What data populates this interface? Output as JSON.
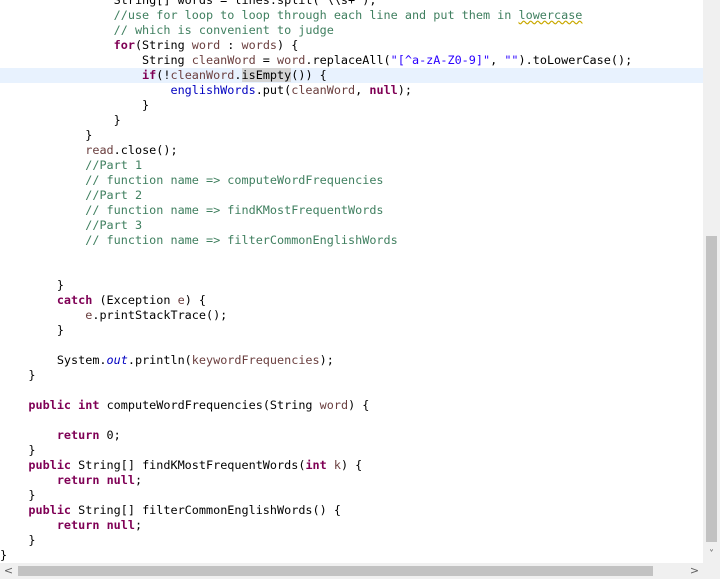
{
  "theme": {
    "keyword": "#7f0055",
    "comment": "#3f7f5f",
    "string": "#2a00ff",
    "field": "#0000c0",
    "variable": "#6a3e3e",
    "current_line": "#e8f2fe",
    "occurrence_highlight": "#d4d4d4"
  },
  "code_lines": [
    {
      "current": false,
      "tokens": [
        {
          "t": "                String[] words = lines.split(\"\\\\s+\");",
          "c": ""
        }
      ]
    },
    {
      "current": false,
      "tokens": [
        {
          "t": "                ",
          "c": ""
        },
        {
          "t": "//use for loop to loop through each line and put them in ",
          "c": "cm"
        },
        {
          "t": "lowercase",
          "c": "cm sq"
        }
      ]
    },
    {
      "current": false,
      "tokens": [
        {
          "t": "                ",
          "c": ""
        },
        {
          "t": "// which is convenient to judge",
          "c": "cm"
        }
      ]
    },
    {
      "current": false,
      "tokens": [
        {
          "t": "                ",
          "c": ""
        },
        {
          "t": "for",
          "c": "kw"
        },
        {
          "t": "(String ",
          "c": ""
        },
        {
          "t": "word",
          "c": "vr"
        },
        {
          "t": " : ",
          "c": ""
        },
        {
          "t": "words",
          "c": "vr"
        },
        {
          "t": ") {",
          "c": ""
        }
      ]
    },
    {
      "current": false,
      "tokens": [
        {
          "t": "                    String ",
          "c": ""
        },
        {
          "t": "cleanWord",
          "c": "vr"
        },
        {
          "t": " = ",
          "c": ""
        },
        {
          "t": "word",
          "c": "vr"
        },
        {
          "t": ".replaceAll(",
          "c": ""
        },
        {
          "t": "\"[^a-zA-Z0-9]\"",
          "c": "st"
        },
        {
          "t": ", ",
          "c": ""
        },
        {
          "t": "\"\"",
          "c": "st"
        },
        {
          "t": ").toLowerCase();",
          "c": ""
        }
      ]
    },
    {
      "current": true,
      "tokens": [
        {
          "t": "                    ",
          "c": ""
        },
        {
          "t": "if",
          "c": "kw"
        },
        {
          "t": "(!",
          "c": ""
        },
        {
          "t": "cleanWord",
          "c": "vr"
        },
        {
          "t": ".",
          "c": ""
        },
        {
          "t": "isEmpty",
          "c": "hl"
        },
        {
          "t": "()) {",
          "c": ""
        }
      ]
    },
    {
      "current": false,
      "tokens": [
        {
          "t": "                        ",
          "c": ""
        },
        {
          "t": "englishWords",
          "c": "fd"
        },
        {
          "t": ".put(",
          "c": ""
        },
        {
          "t": "cleanWord",
          "c": "vr"
        },
        {
          "t": ", ",
          "c": ""
        },
        {
          "t": "null",
          "c": "kw"
        },
        {
          "t": ");",
          "c": ""
        }
      ]
    },
    {
      "current": false,
      "tokens": [
        {
          "t": "                    }",
          "c": ""
        }
      ]
    },
    {
      "current": false,
      "tokens": [
        {
          "t": "                }",
          "c": ""
        }
      ]
    },
    {
      "current": false,
      "tokens": [
        {
          "t": "            }",
          "c": ""
        }
      ]
    },
    {
      "current": false,
      "tokens": [
        {
          "t": "            ",
          "c": ""
        },
        {
          "t": "read",
          "c": "vr"
        },
        {
          "t": ".close();",
          "c": ""
        }
      ]
    },
    {
      "current": false,
      "tokens": [
        {
          "t": "            ",
          "c": ""
        },
        {
          "t": "//Part 1",
          "c": "cm"
        }
      ]
    },
    {
      "current": false,
      "tokens": [
        {
          "t": "            ",
          "c": ""
        },
        {
          "t": "// function name => computeWordFrequencies",
          "c": "cm"
        }
      ]
    },
    {
      "current": false,
      "tokens": [
        {
          "t": "            ",
          "c": ""
        },
        {
          "t": "//Part 2",
          "c": "cm"
        }
      ]
    },
    {
      "current": false,
      "tokens": [
        {
          "t": "            ",
          "c": ""
        },
        {
          "t": "// function name => findKMostFrequentWords",
          "c": "cm"
        }
      ]
    },
    {
      "current": false,
      "tokens": [
        {
          "t": "            ",
          "c": ""
        },
        {
          "t": "//Part 3",
          "c": "cm"
        }
      ]
    },
    {
      "current": false,
      "tokens": [
        {
          "t": "            ",
          "c": ""
        },
        {
          "t": "// function name => filterCommonEnglishWords",
          "c": "cm"
        }
      ]
    },
    {
      "current": false,
      "tokens": [
        {
          "t": "",
          "c": ""
        }
      ]
    },
    {
      "current": false,
      "tokens": [
        {
          "t": "",
          "c": ""
        }
      ]
    },
    {
      "current": false,
      "tokens": [
        {
          "t": "        }",
          "c": ""
        }
      ]
    },
    {
      "current": false,
      "tokens": [
        {
          "t": "        ",
          "c": ""
        },
        {
          "t": "catch",
          "c": "kw"
        },
        {
          "t": " (Exception ",
          "c": ""
        },
        {
          "t": "e",
          "c": "vr"
        },
        {
          "t": ") {",
          "c": ""
        }
      ]
    },
    {
      "current": false,
      "tokens": [
        {
          "t": "            ",
          "c": ""
        },
        {
          "t": "e",
          "c": "vr"
        },
        {
          "t": ".printStackTrace();",
          "c": ""
        }
      ]
    },
    {
      "current": false,
      "tokens": [
        {
          "t": "        }",
          "c": ""
        }
      ]
    },
    {
      "current": false,
      "tokens": [
        {
          "t": "",
          "c": ""
        }
      ]
    },
    {
      "current": false,
      "tokens": [
        {
          "t": "        System.",
          "c": ""
        },
        {
          "t": "out",
          "c": "sf"
        },
        {
          "t": ".println(",
          "c": ""
        },
        {
          "t": "keywordFrequencies",
          "c": "vr"
        },
        {
          "t": ");",
          "c": ""
        }
      ]
    },
    {
      "current": false,
      "tokens": [
        {
          "t": "    }",
          "c": ""
        }
      ]
    },
    {
      "current": false,
      "tokens": [
        {
          "t": "",
          "c": ""
        }
      ]
    },
    {
      "current": false,
      "tokens": [
        {
          "t": "    ",
          "c": ""
        },
        {
          "t": "public",
          "c": "kw"
        },
        {
          "t": " ",
          "c": ""
        },
        {
          "t": "int",
          "c": "kw"
        },
        {
          "t": " computeWordFrequencies(String ",
          "c": ""
        },
        {
          "t": "word",
          "c": "vr"
        },
        {
          "t": ") {",
          "c": ""
        }
      ]
    },
    {
      "current": false,
      "tokens": [
        {
          "t": "",
          "c": ""
        }
      ]
    },
    {
      "current": false,
      "tokens": [
        {
          "t": "        ",
          "c": ""
        },
        {
          "t": "return",
          "c": "kw"
        },
        {
          "t": " 0;",
          "c": ""
        }
      ]
    },
    {
      "current": false,
      "tokens": [
        {
          "t": "    }",
          "c": ""
        }
      ]
    },
    {
      "current": false,
      "tokens": [
        {
          "t": "    ",
          "c": ""
        },
        {
          "t": "public",
          "c": "kw"
        },
        {
          "t": " String[] findKMostFrequentWords(",
          "c": ""
        },
        {
          "t": "int",
          "c": "kw"
        },
        {
          "t": " ",
          "c": ""
        },
        {
          "t": "k",
          "c": "vr"
        },
        {
          "t": ") {",
          "c": ""
        }
      ]
    },
    {
      "current": false,
      "tokens": [
        {
          "t": "        ",
          "c": ""
        },
        {
          "t": "return",
          "c": "kw"
        },
        {
          "t": " ",
          "c": ""
        },
        {
          "t": "null",
          "c": "kw"
        },
        {
          "t": ";",
          "c": ""
        }
      ]
    },
    {
      "current": false,
      "tokens": [
        {
          "t": "    }",
          "c": ""
        }
      ]
    },
    {
      "current": false,
      "tokens": [
        {
          "t": "    ",
          "c": ""
        },
        {
          "t": "public",
          "c": "kw"
        },
        {
          "t": " String[] filterCommonEnglishWords() {",
          "c": ""
        }
      ]
    },
    {
      "current": false,
      "tokens": [
        {
          "t": "        ",
          "c": ""
        },
        {
          "t": "return",
          "c": "kw"
        },
        {
          "t": " ",
          "c": ""
        },
        {
          "t": "null",
          "c": "kw"
        },
        {
          "t": ";",
          "c": ""
        }
      ]
    },
    {
      "current": false,
      "tokens": [
        {
          "t": "    }",
          "c": ""
        }
      ]
    },
    {
      "current": false,
      "tokens": [
        {
          "t": "}",
          "c": ""
        }
      ]
    }
  ],
  "scrollbars": {
    "up_icon": "▲",
    "down_icon": "˅",
    "left_icon": "<",
    "right_icon": ">"
  }
}
